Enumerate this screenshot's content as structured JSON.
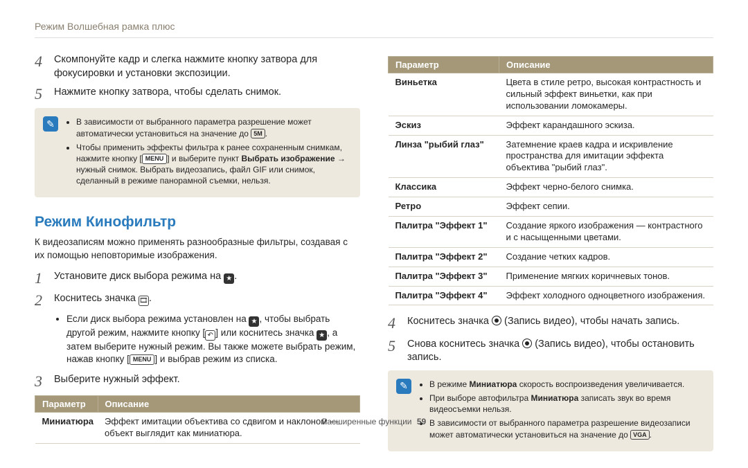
{
  "header": "Режим Волшебная рамка плюс",
  "left": {
    "step4": "Скомпонуйте кадр и слегка нажмите кнопку затвора для фокусировки и установки экспозиции.",
    "step5": "Нажмите кнопку затвора, чтобы сделать снимок.",
    "note1_a": "В зависимости от выбранного параметра разрешение может автоматически установиться на значение до ",
    "note1_a_badge": "5M",
    "note1_b_1": "Чтобы применить эффекты фильтра к ранее сохраненным снимкам, нажмите кнопку [",
    "note1_b_menu": "MENU",
    "note1_b_2": "] и выберите пункт ",
    "note1_b_bold": "Выбрать изображение",
    "note1_b_3": " → нужный снимок. Выбрать видеозапись, файл GIF или снимок, сделанный в режиме панорамной съемки, нельзя.",
    "section_title": "Режим Кинофильтр",
    "section_intro": "К видеозаписям можно применять разнообразные фильтры, создавая с их помощью неповторимые изображения.",
    "step_l1_pre": "Установите диск выбора режима на ",
    "step_l2_pre": "Коснитесь значка ",
    "sub_bullet_1a": "Если диск выбора режима установлен на ",
    "sub_bullet_1b": ", чтобы выбрать другой режим, нажмите кнопку [",
    "sub_bullet_1c": "] или коснитесь значка ",
    "sub_bullet_1d": ", а затем выберите нужный режим. Вы также можете выбрать режим, нажав кнопку [",
    "sub_bullet_1e": "] и выбрав режим из списка.",
    "step_l3": "Выберите нужный эффект.",
    "table_left_headers": {
      "param": "Параметр",
      "desc": "Описание"
    },
    "table_left_rows": [
      {
        "param": "Миниатюра",
        "desc": "Эффект имитации объектива со сдвигом и наклоном — объект выглядит как миниатюра."
      }
    ]
  },
  "right": {
    "table_headers": {
      "param": "Параметр",
      "desc": "Описание"
    },
    "table_rows": [
      {
        "param": "Виньетка",
        "desc": "Цвета в стиле ретро, высокая контрастность и сильный эффект виньетки, как при использовании ломокамеры."
      },
      {
        "param": "Эскиз",
        "desc": "Эффект карандашного эскиза."
      },
      {
        "param": "Линза \"рыбий глаз\"",
        "desc": "Затемнение краев кадра и искривление пространства для имитации эффекта объектива \"рыбий глаз\"."
      },
      {
        "param": "Классика",
        "desc": "Эффект черно-белого снимка."
      },
      {
        "param": "Ретро",
        "desc": "Эффект сепии."
      },
      {
        "param": "Палитра \"Эффект 1\"",
        "desc": "Создание яркого изображения — контрастного и с насыщенными цветами."
      },
      {
        "param": "Палитра \"Эффект 2\"",
        "desc": "Создание четких кадров."
      },
      {
        "param": "Палитра \"Эффект 3\"",
        "desc": "Применение мягких коричневых тонов."
      },
      {
        "param": "Палитра \"Эффект 4\"",
        "desc": "Эффект холодного одноцветного изображения."
      }
    ],
    "step4_pre": "Коснитесь значка ",
    "step4_post": " (Запись видео), чтобы начать запись.",
    "step5_pre": "Снова коснитесь значка ",
    "step5_post": " (Запись видео), чтобы остановить запись.",
    "note_items": {
      "a_pre": "В режиме ",
      "a_bold": "Миниатюра",
      "a_post": " скорость воспроизведения увеличивается.",
      "b_pre": "При выборе автофильтра ",
      "b_bold": "Миниатюра",
      "b_post": " записать звук во время видеосъемки нельзя.",
      "c_pre": "В зависимости от выбранного параметра разрешение видеозаписи может автоматически установиться на значение до ",
      "c_badge": "VGA"
    }
  },
  "footer": {
    "label": "Расширенные функции",
    "page": "59"
  }
}
